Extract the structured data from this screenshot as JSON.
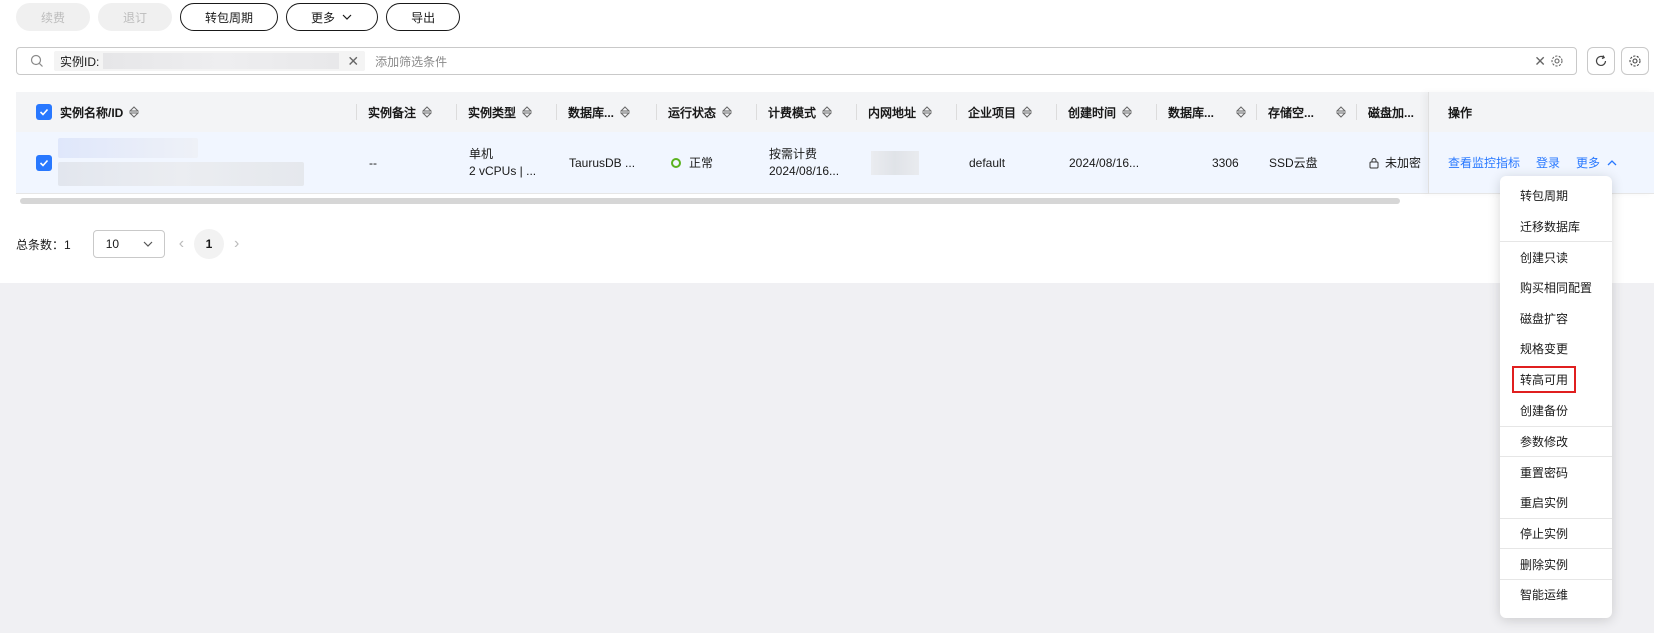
{
  "toolbar": {
    "renew": "续费",
    "unsubscribe": "退订",
    "to_period": "转包周期",
    "more": "更多",
    "export": "导出"
  },
  "search": {
    "tag_key": "实例ID:",
    "placeholder": "添加筛选条件"
  },
  "table": {
    "headers": [
      "实例名称/ID",
      "实例备注",
      "实例类型",
      "数据库...",
      "运行状态",
      "计费模式",
      "内网地址",
      "企业项目",
      "创建时间",
      "数据库...",
      "存储空...",
      "磁盘加...",
      "操作"
    ],
    "row": {
      "remark": "--",
      "type_line1": "单机",
      "type_line2": "2 vCPUs | ...",
      "db_engine": "TaurusDB ...",
      "status": "正常",
      "billing_line1": "按需计费",
      "billing_line2": "2024/08/16...",
      "enterprise": "default",
      "created": "2024/08/16...",
      "port": "3306",
      "storage": "SSD云盘",
      "encryption": "未加密",
      "op_monitor": "查看监控指标",
      "op_login": "登录",
      "op_more": "更多"
    }
  },
  "pager": {
    "total": "总条数：1",
    "page_size": "10",
    "current": "1"
  },
  "dropdown": {
    "items": [
      "转包周期",
      "迁移数据库",
      "创建只读",
      "购买相同配置",
      "磁盘扩容",
      "规格变更",
      "转高可用",
      "创建备份",
      "参数修改",
      "重置密码",
      "重启实例",
      "停止实例",
      "删除实例",
      "智能运维"
    ]
  },
  "colors": {
    "accent": "#2878ff",
    "status_ok": "#5bb21f",
    "highlight": "#e01f1f"
  }
}
